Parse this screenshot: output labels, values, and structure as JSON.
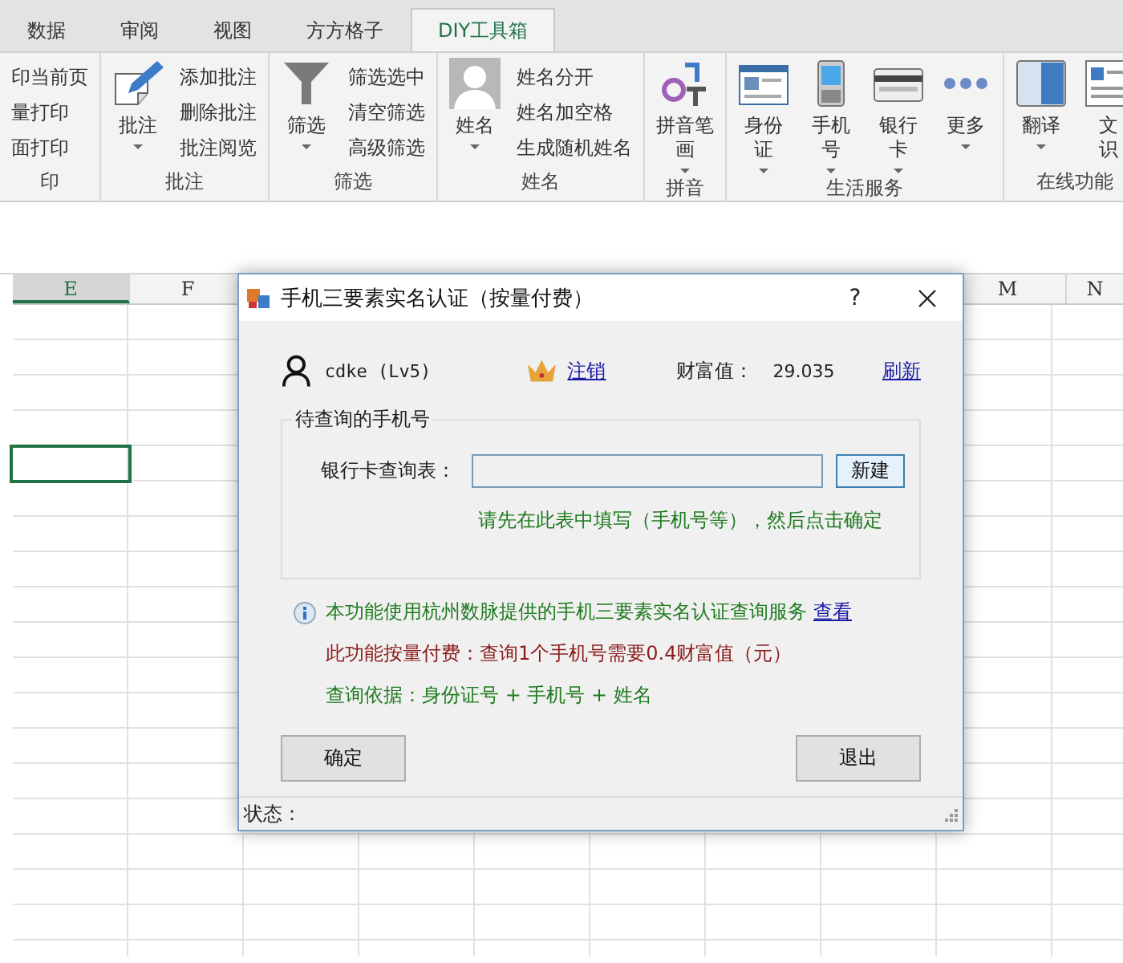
{
  "ribbon_tabs": [
    {
      "label": "数据",
      "selected": false
    },
    {
      "label": "审阅",
      "selected": false
    },
    {
      "label": "视图",
      "selected": false
    },
    {
      "label": "方方格子",
      "selected": false
    },
    {
      "label": "DIY工具箱",
      "selected": true
    }
  ],
  "ribbon_groups": [
    {
      "label": "印",
      "small_buttons": [
        "印当前页",
        "量打印",
        "面打印"
      ]
    },
    {
      "label": "批注",
      "large_buttons": [
        {
          "kind": "pencil",
          "lines": [
            "批注"
          ],
          "dropdown": true
        }
      ],
      "small_buttons": [
        "添加批注",
        "删除批注",
        "批注阅览"
      ]
    },
    {
      "label": "筛选",
      "large_buttons": [
        {
          "kind": "funnel",
          "lines": [
            "筛选"
          ],
          "dropdown": true
        }
      ],
      "small_buttons": [
        "筛选选中",
        "清空筛选",
        "高级筛选"
      ]
    },
    {
      "label": "姓名",
      "large_buttons": [
        {
          "kind": "avatar",
          "lines": [
            "姓名"
          ],
          "dropdown": true
        }
      ],
      "small_buttons": [
        "姓名分开",
        "姓名加空格",
        "生成随机姓名"
      ]
    },
    {
      "label": "拼音",
      "large_buttons": [
        {
          "kind": "pinyin",
          "lines": [
            "拼音笔",
            "画"
          ],
          "dropdown": true
        }
      ]
    },
    {
      "label": "生活服务",
      "large_buttons": [
        {
          "kind": "idcard",
          "lines": [
            "身份",
            "证"
          ],
          "dropdown": true
        },
        {
          "kind": "phone",
          "lines": [
            "手机",
            "号"
          ],
          "dropdown": true
        },
        {
          "kind": "bankcard",
          "lines": [
            "银行",
            "卡"
          ],
          "dropdown": true
        },
        {
          "kind": "dots",
          "lines": [
            "更多"
          ],
          "dropdown": true
        }
      ]
    },
    {
      "label": "在线功能",
      "large_buttons": [
        {
          "kind": "translate",
          "lines": [
            "翻译"
          ],
          "dropdown": true
        },
        {
          "kind": "document",
          "lines": [
            "文",
            "识"
          ],
          "dropdown": false
        }
      ]
    }
  ],
  "sheet": {
    "columns": [
      {
        "label": "E",
        "selected": true
      },
      {
        "label": "F",
        "selected": false
      },
      {
        "label": "M",
        "selected": false
      },
      {
        "label": "N",
        "selected": false
      }
    ]
  },
  "dialog": {
    "title": "手机三要素实名认证（按量付费）",
    "help": "?",
    "user": {
      "name": "cdke (Lv5)",
      "logout_link": "注销",
      "wealth_label": "财富值：",
      "wealth_value": "29.035",
      "refresh_link": "刷新"
    },
    "group": {
      "legend": "待查询的手机号",
      "field_label": "银行卡查询表：",
      "new_button": "新建",
      "hint": "请先在此表中填写（手机号等），然后点击确定"
    },
    "notes": [
      {
        "kind": "info",
        "text": "本功能使用杭州数脉提供的手机三要素实名认证查询服务",
        "link": "查看",
        "color": "#1e7a1e"
      },
      {
        "kind": "plain",
        "text": "此功能按量付费：查询1个手机号需要0.4财富值（元）",
        "color": "#8b1a1a"
      },
      {
        "kind": "plain",
        "text": "查询依据：身份证号 + 手机号 + 姓名",
        "color": "#1e7a1e"
      }
    ],
    "buttons": [
      "确定",
      "退出"
    ],
    "status_label": "状态："
  }
}
